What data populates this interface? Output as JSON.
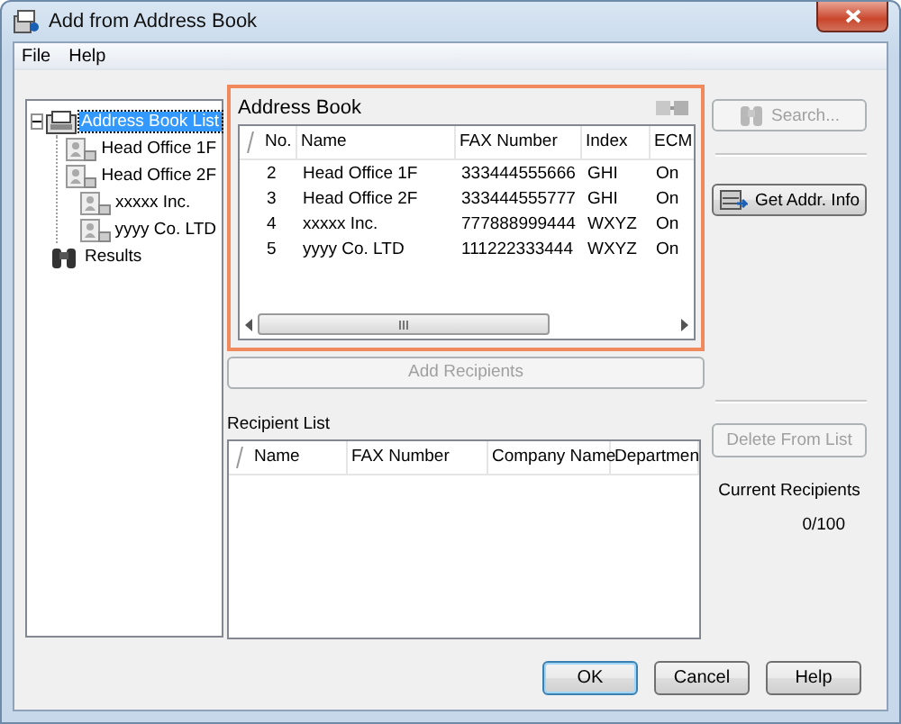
{
  "window": {
    "title": "Add from Address Book"
  },
  "menu": [
    {
      "label": "File"
    },
    {
      "label": "Help"
    }
  ],
  "tree": [
    {
      "label": "Address Book List",
      "kind": "book_list",
      "selected": true,
      "expanded": true,
      "children": [
        {
          "label": "Head Office 1F",
          "kind": "contact",
          "selected": false
        },
        {
          "label": "Head Office 2F",
          "kind": "contact",
          "selected": false
        },
        {
          "label": "xxxxx Inc.",
          "kind": "contact",
          "selected": false
        },
        {
          "label": "yyyy Co. LTD",
          "kind": "contact",
          "selected": false
        }
      ]
    },
    {
      "label": "Results",
      "kind": "results",
      "selected": false
    }
  ],
  "address_book": {
    "title": "Address Book",
    "columns": [
      "No.",
      "Name",
      "FAX Number",
      "Index",
      "ECM"
    ],
    "rows": [
      [
        "2",
        "Head Office 1F",
        "333444555666",
        "GHI",
        "On"
      ],
      [
        "3",
        "Head Office 2F",
        "333444555777",
        "GHI",
        "On"
      ],
      [
        "4",
        "xxxxx Inc.",
        "777888999444",
        "WXYZ",
        "On"
      ],
      [
        "5",
        "yyyy Co. LTD",
        "111222333444",
        "WXYZ",
        "On"
      ]
    ]
  },
  "add_button": {
    "label": "Add Recipients",
    "disabled": true
  },
  "recipient_list": {
    "title": "Recipient List",
    "columns": [
      "Name",
      "FAX Number",
      "Company Name",
      "Departmen"
    ]
  },
  "side_buttons": [
    {
      "label": "Search...",
      "kind": "search",
      "disabled": true
    },
    {
      "label": "Get Addr. Info",
      "kind": "get_info",
      "disabled": false
    }
  ],
  "delete_button": {
    "label": "Delete From List",
    "disabled": true
  },
  "recipients_count": {
    "label": "Current Recipients",
    "value": "0/100"
  },
  "footer_buttons": [
    {
      "label": "OK",
      "default": true
    },
    {
      "label": "Cancel",
      "default": false
    },
    {
      "label": "Help",
      "default": false
    }
  ]
}
